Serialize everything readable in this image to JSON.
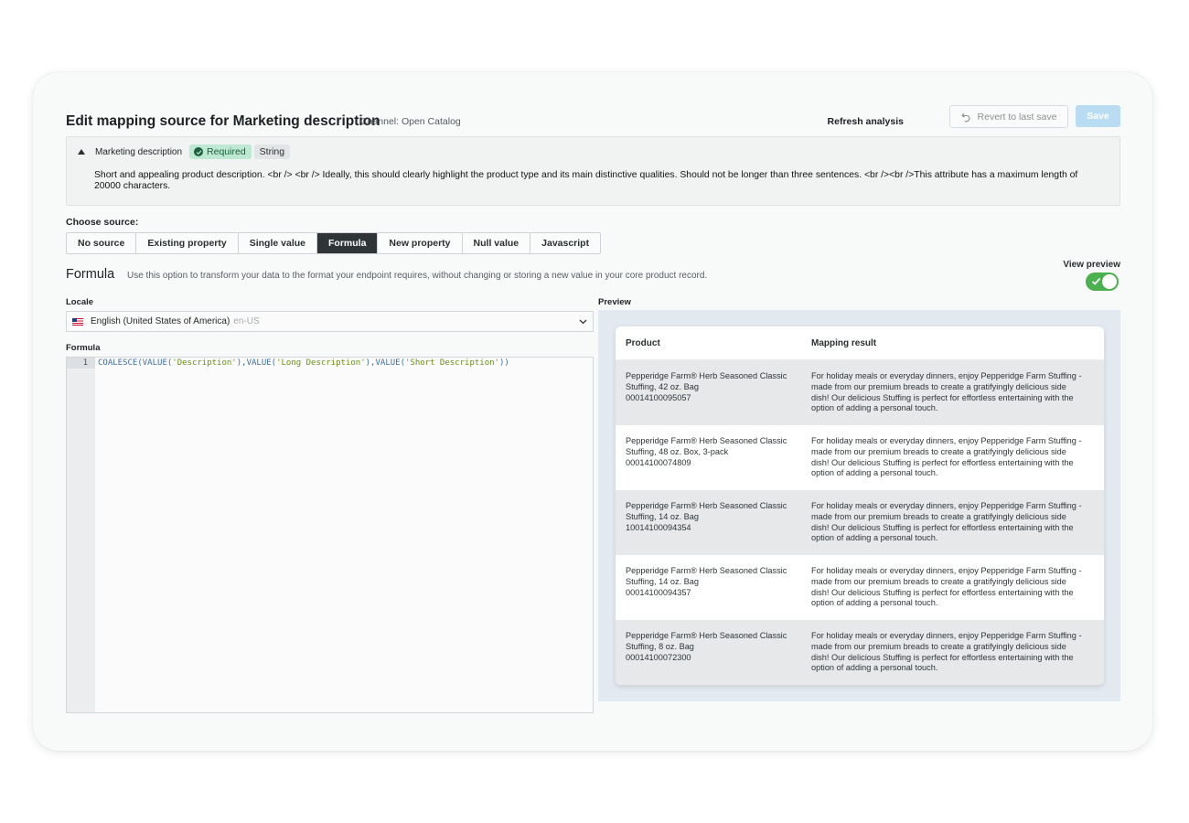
{
  "header": {
    "title": "Edit mapping source for Marketing description",
    "channel": "Channel: Open Catalog",
    "refresh_label": "Refresh analysis",
    "revert_label": "Revert to last save",
    "save_label": "Save"
  },
  "attribute": {
    "name": "Marketing description",
    "required_badge": "Required",
    "type_badge": "String",
    "description": "Short and appealing product description. <br /> <br /> Ideally, this should clearly highlight the product type and its main distinctive qualities. Should not be longer than three sentences. <br /><br />This attribute has a maximum length of 20000 characters."
  },
  "source": {
    "label": "Choose source:",
    "tabs": [
      "No source",
      "Existing property",
      "Single value",
      "Formula",
      "New property",
      "Null value",
      "Javascript"
    ],
    "active_tab": "Formula"
  },
  "formula_section": {
    "title": "Formula",
    "subtitle": "Use this option to transform your data to the format your endpoint requires, without changing or storing a new value in your core product record.",
    "view_preview_label": "View preview",
    "view_preview_on": true
  },
  "locale": {
    "label": "Locale",
    "value": "English (United States of America)",
    "code": "en-US"
  },
  "editor": {
    "label": "Formula",
    "line_number": "1",
    "code_parts": [
      "COALESCE(VALUE(",
      "'Description'",
      "),VALUE(",
      "'Long Description'",
      "),VALUE(",
      "'Short Description'",
      "))"
    ]
  },
  "preview": {
    "label": "Preview",
    "columns": [
      "Product",
      "Mapping result"
    ],
    "rows": [
      {
        "product": "Pepperidge Farm® Herb Seasoned Classic Stuffing, 42 oz. Bag",
        "sku": "00014100095057",
        "result": "For holiday meals or everyday dinners, enjoy Pepperidge Farm Stuffing - made from our premium breads to create a gratifyingly delicious side dish! Our delicious Stuffing is perfect for effortless entertaining with the option of adding a personal touch."
      },
      {
        "product": "Pepperidge Farm® Herb Seasoned Classic Stuffing, 48 oz. Box, 3-pack",
        "sku": "00014100074809",
        "result": "For holiday meals or everyday dinners, enjoy Pepperidge Farm Stuffing - made from our premium breads to create a gratifyingly delicious side dish! Our delicious Stuffing is perfect for effortless entertaining with the option of adding a personal touch."
      },
      {
        "product": "Pepperidge Farm® Herb Seasoned Classic Stuffing, 14 oz. Bag",
        "sku": "10014100094354",
        "result": "For holiday meals or everyday dinners, enjoy Pepperidge Farm Stuffing - made from our premium breads to create a gratifyingly delicious side dish! Our delicious Stuffing is perfect for effortless entertaining with the option of adding a personal touch."
      },
      {
        "product": "Pepperidge Farm® Herb Seasoned Classic Stuffing, 14 oz. Bag",
        "sku": "00014100094357",
        "result": "For holiday meals or everyday dinners, enjoy Pepperidge Farm Stuffing - made from our premium breads to create a gratifyingly delicious side dish! Our delicious Stuffing is perfect for effortless entertaining with the option of adding a personal touch."
      },
      {
        "product": "Pepperidge Farm® Herb Seasoned Classic Stuffing, 8 oz. Bag",
        "sku": "00014100072300",
        "result": "For holiday meals or everyday dinners, enjoy Pepperidge Farm Stuffing - made from our premium breads to create a gratifyingly delicious side dish! Our delicious Stuffing is perfect for effortless entertaining with the option of adding a personal touch."
      }
    ]
  },
  "colors": {
    "save_button": "#b9dcf3",
    "active_tab": "#2f3437",
    "required_badge": "#bfe8d3",
    "toggle_on": "#4caf50",
    "preview_panel": "#e3e9f0"
  }
}
